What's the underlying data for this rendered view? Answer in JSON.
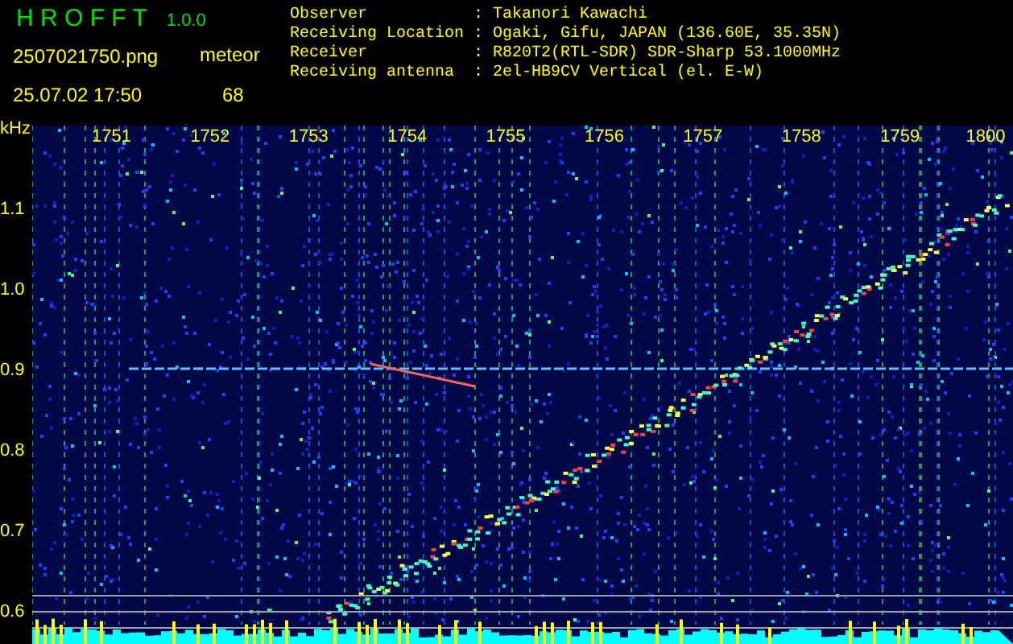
{
  "header": {
    "app_name": "H R O F F T",
    "version": "1.0.0",
    "filename": "2507021750.png",
    "datetime": "25.07.02 17:50",
    "meteor_label": "meteor",
    "meteor_count": "68"
  },
  "info": [
    {
      "label": "Observer",
      "value": ": Takanori Kawachi"
    },
    {
      "label": "Receiving Location",
      "value": ": Ogaki, Gifu, JAPAN (136.60E, 35.35N)"
    },
    {
      "label": "Receiver",
      "value": ": R820T2(RTL-SDR) SDR-Sharp 53.1000MHz"
    },
    {
      "label": "Receiving antenna",
      "value": ": 2el-HB9CV Vertical (el. E-W)"
    }
  ],
  "axis": {
    "unit": "kHz",
    "y_labels": [
      "1.1",
      "1.0",
      "0.9",
      "0.8",
      "0.7",
      "0.6"
    ],
    "x_labels": [
      "1751",
      "1752",
      "1753",
      "1754",
      "1755",
      "1756",
      "1757",
      "1758",
      "1759",
      "1800"
    ]
  }
}
